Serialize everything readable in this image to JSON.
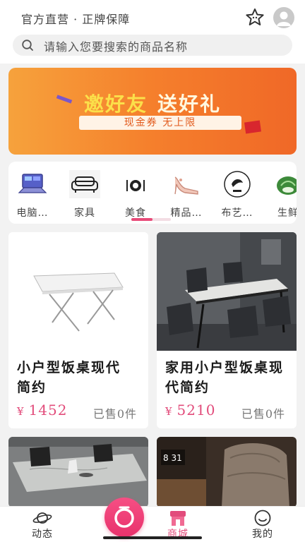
{
  "header": {
    "tagline": "官方直营 · 正牌保障",
    "search_placeholder": "请输入您要搜索的商品名称"
  },
  "banner": {
    "title_part1": "邀好友",
    "title_part2": "送好礼",
    "subtitle": "现金券 无上限",
    "colors": {
      "start": "#f6a23c",
      "end": "#f06827",
      "title": "#fbe04a"
    }
  },
  "categories": [
    {
      "label": "电脑…",
      "icon": "laptop-icon"
    },
    {
      "label": "家具",
      "icon": "sofa-icon"
    },
    {
      "label": "美食",
      "icon": "dining-icon"
    },
    {
      "label": "精品…",
      "icon": "high-heel-icon"
    },
    {
      "label": "布艺…",
      "icon": "fabric-logo-icon"
    },
    {
      "label": "生鲜",
      "icon": "vegetable-icon"
    }
  ],
  "products": [
    {
      "title": "小户型饭桌现代简约",
      "currency": "¥",
      "price": "1452",
      "sold": "已售0件",
      "image": "folding-table-image"
    },
    {
      "title": "家用小户型饭桌现代简约",
      "currency": "¥",
      "price": "5210",
      "sold": "已售0件",
      "image": "dining-set-image"
    },
    {
      "title": "",
      "image": "marble-dining-table-image"
    },
    {
      "title": "",
      "image": "recliner-chair-image",
      "image_clock_text": "8 31"
    }
  ],
  "nav": {
    "items": [
      {
        "label": "动态",
        "icon": "planet-icon"
      },
      {
        "label": "商城",
        "icon": "shop-icon",
        "active": true
      },
      {
        "label": "我的",
        "icon": "smiley-icon"
      }
    ]
  },
  "colors": {
    "accent": "#e24c7b",
    "background": "#f2f2f2"
  }
}
